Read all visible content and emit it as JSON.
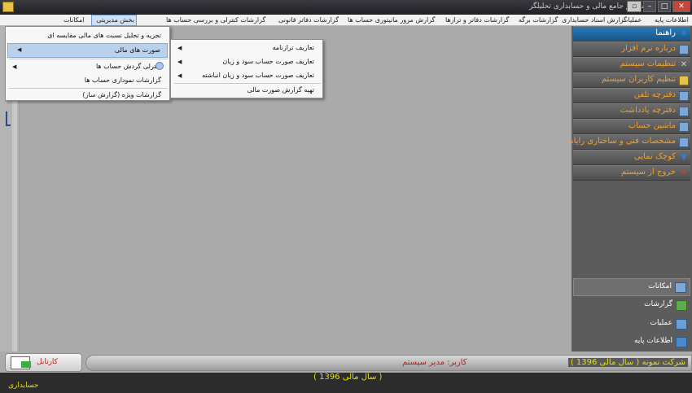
{
  "window": {
    "title": "سیستم جامع مالی و حسابداری تحلیلگر"
  },
  "menubar": {
    "items": [
      "اطلاعات پایه",
      "عملیات",
      "گزارش اسناد حسابداری",
      "گزارشات برگه",
      "گزارشات دفاتر و ترازها",
      "گزارش مرور مانیتوری حساب ها",
      "گزارشات دفاتر قانونی",
      "گزارشات کنترلی و بررسی حساب ها",
      "بخش مدیریتی",
      "امکانات"
    ]
  },
  "dropdown_main": {
    "items": [
      "تجزیه و تحلیل نسبت های مالی مقایسه ای",
      "صورت های مالی",
      "کنترلی گردش حساب ها",
      "گزارشات نموداری حساب ها",
      "گزارشات ویژه (گزارش ساز)"
    ]
  },
  "dropdown_sub": {
    "items": [
      "تعاریف ترازنامه",
      "تعاریف صورت حساب سود و زیان",
      "تعاریف صورت حساب سود و زیان انباشته",
      "تهیه گزارش صورت مالی"
    ]
  },
  "sidebar": {
    "items": [
      {
        "label": "راهنما",
        "icon": "help-icon"
      },
      {
        "label": "درباره نرم افزار",
        "icon": "info-icon"
      },
      {
        "label": "تنظیمات سیستم",
        "icon": "tools-icon"
      },
      {
        "label": "تنظیم کاربران سیستم",
        "icon": "users-icon"
      },
      {
        "label": "دفترچه تلفن",
        "icon": "phone-book-icon"
      },
      {
        "label": "دفترچه یادداشت",
        "icon": "notepad-icon"
      },
      {
        "label": "ماشین حساب",
        "icon": "calculator-icon"
      },
      {
        "label": "مشخصات فنی و ساختاری رایانه",
        "icon": "computer-icon"
      },
      {
        "label": "کوچک نمایی",
        "icon": "minimize-icon"
      },
      {
        "label": "خروج از سیستم",
        "icon": "exit-icon"
      }
    ],
    "bottom": [
      {
        "label": "امکانات",
        "icon": "features-icon"
      },
      {
        "label": "گزارشات",
        "icon": "reports-icon"
      },
      {
        "label": "عملیات",
        "icon": "operations-icon"
      },
      {
        "label": "اطلاعات پایه",
        "icon": "base-info-icon"
      }
    ]
  },
  "status": {
    "user": "کاربر: مدیر سیستم",
    "company": "شرکت نمونه ( سال مالی 1396 )",
    "kartabl": "کارتابل"
  },
  "footer": {
    "year": "( سال مالی 1396 )",
    "mode": "حسابداری"
  }
}
